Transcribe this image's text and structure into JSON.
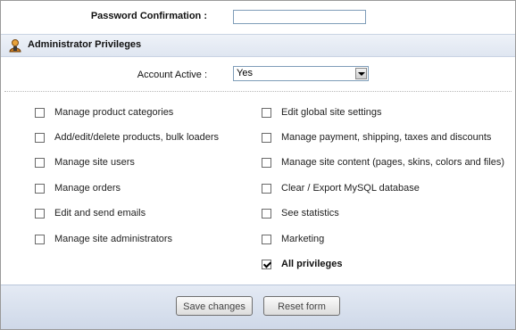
{
  "password_confirmation": {
    "label": "Password Confirmation :",
    "value": ""
  },
  "section": {
    "title": "Administrator Privileges",
    "icon": "user-admin-icon"
  },
  "account_active": {
    "label": "Account Active :",
    "value": "Yes"
  },
  "privileges": {
    "left": [
      {
        "label": "Manage product categories",
        "checked": false
      },
      {
        "label": "Add/edit/delete products, bulk loaders",
        "checked": false
      },
      {
        "label": "Manage site users",
        "checked": false
      },
      {
        "label": "Manage orders",
        "checked": false
      },
      {
        "label": "Edit and send emails",
        "checked": false
      },
      {
        "label": "Manage site administrators",
        "checked": false
      }
    ],
    "right": [
      {
        "label": "Edit global site settings",
        "checked": false
      },
      {
        "label": "Manage payment, shipping, taxes and discounts",
        "checked": false
      },
      {
        "label": "Manage site content (pages, skins, colors and files)",
        "checked": false
      },
      {
        "label": "Clear / Export MySQL database",
        "checked": false
      },
      {
        "label": "See statistics",
        "checked": false
      },
      {
        "label": "Marketing",
        "checked": false
      },
      {
        "label": "All privileges",
        "checked": true
      }
    ]
  },
  "buttons": {
    "save": "Save changes",
    "reset": "Reset form"
  }
}
